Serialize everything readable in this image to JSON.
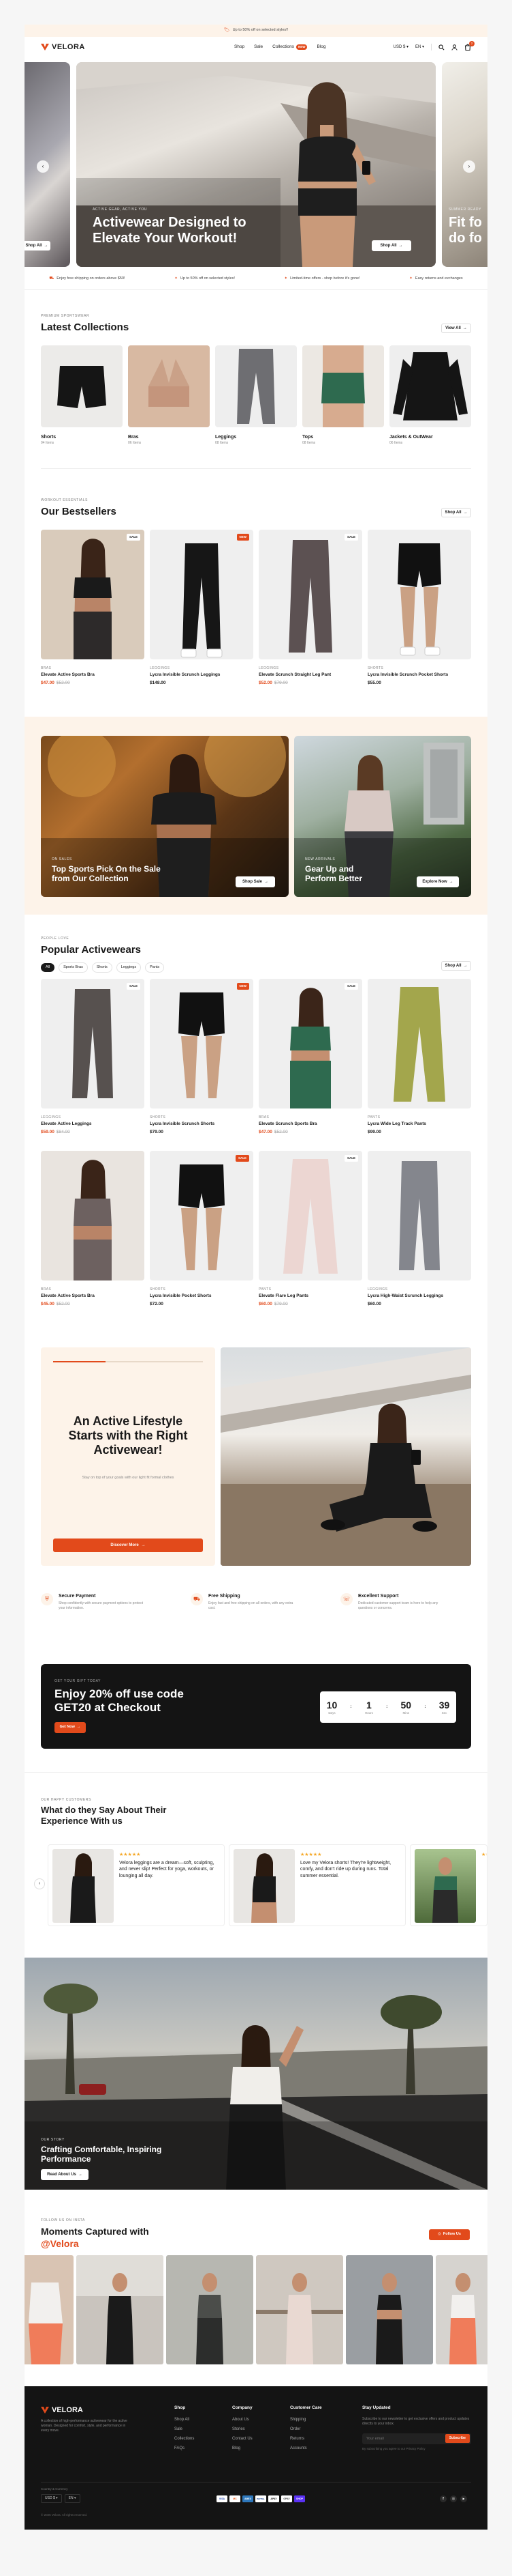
{
  "announcement": {
    "text": "Up to 50% off on selected styles!!"
  },
  "header": {
    "logo": "VELORA",
    "nav": [
      {
        "label": "Shop"
      },
      {
        "label": "Sale"
      },
      {
        "label": "Collections"
      },
      {
        "label": "Blog"
      }
    ],
    "nav_badge": "NEW",
    "currency": "USD $",
    "language": "EN",
    "cart_count": "2"
  },
  "hero": {
    "left_button": "Shop All",
    "eyebrow": "ACTIVE GEAR, ACTIVE YOU",
    "title": "Activewear Designed to Elevate Your Workout!",
    "button": "Shop All",
    "right_eyebrow": "SUMMER READY",
    "right_title": "Fit fo do fo"
  },
  "marquee": [
    "Enjoy free shipping on orders above $50!",
    "Up to 50% off on selected styles!",
    "Limited-time offers - shop before it's gone!",
    "Easy returns and exchanges"
  ],
  "collections": {
    "eyebrow": "PREMIUM SPORTSWEAR",
    "title": "Latest Collections",
    "view_all": "View All",
    "items": [
      {
        "name": "Shorts",
        "count": "04 Items"
      },
      {
        "name": "Bras",
        "count": "06 Items"
      },
      {
        "name": "Leggings",
        "count": "08 Items"
      },
      {
        "name": "Tops",
        "count": "08 Items"
      },
      {
        "name": "Jackets & OutWear",
        "count": "06 Items"
      }
    ]
  },
  "bestsellers": {
    "eyebrow": "WORKOUT ESSENTIALS",
    "title": "Our Bestsellers",
    "shop_all": "Shop All",
    "items": [
      {
        "category": "BRAS",
        "name": "Elevate Active Sports Bra",
        "price": "$47.00",
        "old": "$52.00",
        "badge": "SALE"
      },
      {
        "category": "LEGGINGS",
        "name": "Lycra Invisible Scrunch Leggings",
        "price": "$148.00",
        "old": "",
        "badge": "NEW"
      },
      {
        "category": "LEGGINGS",
        "name": "Elevate Scrunch Straight Leg Pant",
        "price": "$52.00",
        "old": "$79.00",
        "badge": "SALE"
      },
      {
        "category": "SHORTS",
        "name": "Lycra Invisible Scrunch Pocket Shorts",
        "price": "$55.00",
        "old": "",
        "badge": ""
      }
    ]
  },
  "promos": [
    {
      "eyebrow": "ON SALES",
      "title": "Top Sports Pick On the Sale from Our Collection",
      "button": "Shop Sale"
    },
    {
      "eyebrow": "NEW ARRIVALS",
      "title": "Gear Up and Perform Better",
      "button": "Explore Now"
    }
  ],
  "popular": {
    "eyebrow": "PEOPLE LOVE",
    "title": "Popular Activewears",
    "filters": [
      "All",
      "Sports Bras",
      "Shorts",
      "Leggings",
      "Pants"
    ],
    "shop_all": "Shop All",
    "items": [
      {
        "category": "LEGGINGS",
        "name": "Elevate Active Leggings",
        "price": "$59.00",
        "old": "$84.00",
        "badge": "SALE"
      },
      {
        "category": "SHORTS",
        "name": "Lycra Invisible Scrunch Shorts",
        "price": "$79.00",
        "old": "",
        "badge": "NEW"
      },
      {
        "category": "BRAS",
        "name": "Elevate Scrunch Sports Bra",
        "price": "$47.00",
        "old": "$52.00",
        "badge": "SALE"
      },
      {
        "category": "PANTS",
        "name": "Lycra Wide Leg Track Pants",
        "price": "$99.00",
        "old": "",
        "badge": ""
      },
      {
        "category": "BRAS",
        "name": "Elevate Active Sports Bra",
        "price": "$45.00",
        "old": "$52.00",
        "badge": ""
      },
      {
        "category": "SHORTS",
        "name": "Lycra Invisible Pocket Shorts",
        "price": "$72.00",
        "old": "",
        "badge": "SALE"
      },
      {
        "category": "PANTS",
        "name": "Elevate Flare Leg Pants",
        "price": "$60.00",
        "old": "$79.00",
        "badge": "SALE"
      },
      {
        "category": "LEGGINGS",
        "name": "Lycra High-Waist Scrunch Leggings",
        "price": "$60.00",
        "old": "",
        "badge": ""
      }
    ]
  },
  "lifestyle": {
    "title": "An Active Lifestyle Starts with the Right Activewear!",
    "subtitle": "Stay on top of your goals with our light fit formal clothes",
    "button": "Discover More"
  },
  "features": [
    {
      "title": "Secure Payment",
      "text": "Shop confidently with secure payment options to protect your information."
    },
    {
      "title": "Free Shipping",
      "text": "Enjoy fast and free shipping on all orders, with any extra cost."
    },
    {
      "title": "Excellent Support",
      "text": "Dedicated customer support team is here to help any questions or concerns."
    }
  ],
  "offer": {
    "eyebrow": "GET YOUR GIFT TODAY",
    "title": "Enjoy 20% off use code GET20 at Checkout",
    "button": "Get Now",
    "countdown": [
      {
        "value": "10",
        "label": "Days"
      },
      {
        "value": "1",
        "label": "Hours"
      },
      {
        "value": "50",
        "label": "Mins"
      },
      {
        "value": "39",
        "label": "Sec"
      }
    ]
  },
  "testimonials": {
    "eyebrow": "OUR HAPPY CUSTOMERS",
    "title": "What do they Say About Their Experience With us",
    "items": [
      {
        "stars": "★★★★★",
        "text": "Velora leggings are a dream—soft, sculpting, and never slip! Perfect for yoga, workouts, or lounging all day."
      },
      {
        "stars": "★★★★★",
        "text": "Love my Velora shorts! They're lightweight, comfy, and don't ride up during runs. Total summer essential."
      },
      {
        "stars": "★★",
        "text": ""
      }
    ]
  },
  "story": {
    "eyebrow": "OUR STORY",
    "title": "Crafting Comfortable, Inspiring Performance",
    "button": "Read About Us"
  },
  "instagram": {
    "eyebrow": "FOLLOW US ON INSTA",
    "title": "Moments Captured with",
    "handle": "@Velora",
    "button": "Follow Us"
  },
  "footer": {
    "logo": "VELORA",
    "about": "A collection of high-performance activewear for the active woman. Designed for comfort, style, and performance in every move.",
    "columns": [
      {
        "title": "Shop",
        "links": [
          "Shop All",
          "Sale",
          "Collections",
          "FAQs"
        ]
      },
      {
        "title": "Company",
        "links": [
          "About Us",
          "Stories",
          "Contact Us",
          "Blog"
        ]
      },
      {
        "title": "Customer Care",
        "links": [
          "Shipping",
          "Order",
          "Returns",
          "Accounts"
        ]
      }
    ],
    "newsletter_title": "Stay Updated",
    "newsletter_text": "Subscribe to our newsletter to get exclusive offers and product updates directly to your inbox.",
    "email_placeholder": "Your email",
    "subscribe": "Subscribe",
    "terms": "By subscribing you agree to our Privacy Policy",
    "country_label": "Country & Currency",
    "currency": "USD $",
    "language": "EN",
    "payments": [
      "VISA",
      "MC",
      "AMEX",
      "PAYPAL",
      "APAY",
      "GPAY",
      "SHOP"
    ],
    "copyright": "© 2025 Velora. All rights reserved."
  },
  "colors": {
    "accent": "#e24a1b",
    "dark": "#1a1a1a",
    "cream": "#fdf3e9"
  }
}
